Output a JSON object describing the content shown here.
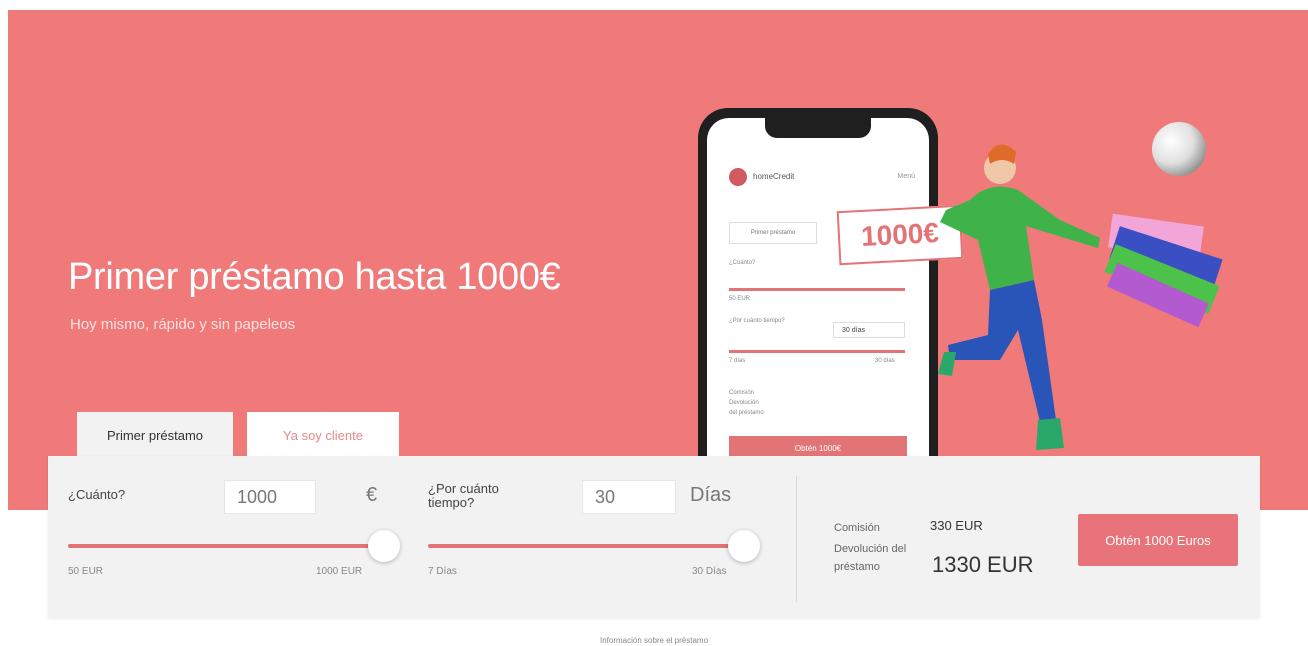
{
  "hero": {
    "title": "Primer préstamo hasta 1000€",
    "subtitle": "Hoy mismo, rápido y sin papeleos",
    "bubble": "1000€"
  },
  "tabs": [
    {
      "label": "Primer préstamo",
      "active": true
    },
    {
      "label": "Ya soy cliente",
      "active": false
    }
  ],
  "calculator": {
    "amount": {
      "label": "¿Cuánto?",
      "value": "1000",
      "unit": "€",
      "min_label": "50 EUR",
      "max_label": "1000 EUR",
      "fraction": 1.0
    },
    "term": {
      "label": "¿Por cuánto tiempo?",
      "value": "30",
      "unit": "Días",
      "min_label": "7 Días",
      "max_label": "30 Días",
      "fraction": 1.0
    },
    "summary": {
      "commission_label": "Comisión",
      "commission_value": "330 EUR",
      "return_label": "Devolución del préstamo",
      "return_value": "1330 EUR"
    },
    "cta_label": "Obtén 1000 Euros"
  },
  "phone": {
    "brand": "homeCredit",
    "menu": "Menú",
    "tab": "Primer préstamo",
    "amount_label": "¿Cuánto?",
    "amount_min": "50 EUR",
    "term_label": "¿Por cuánto tiempo?",
    "term_value": "30 días",
    "term_min": "7 días",
    "term_max": "30 días",
    "summary_lines": [
      "Comisión",
      "Devolución",
      "del préstamo"
    ],
    "button": "Obtén 1000€"
  },
  "footnote": "Información sobre el préstamo",
  "colors": {
    "hero_bg": "#f07a7a",
    "accent": "#e27476",
    "panel_bg": "#f2f2f2"
  }
}
